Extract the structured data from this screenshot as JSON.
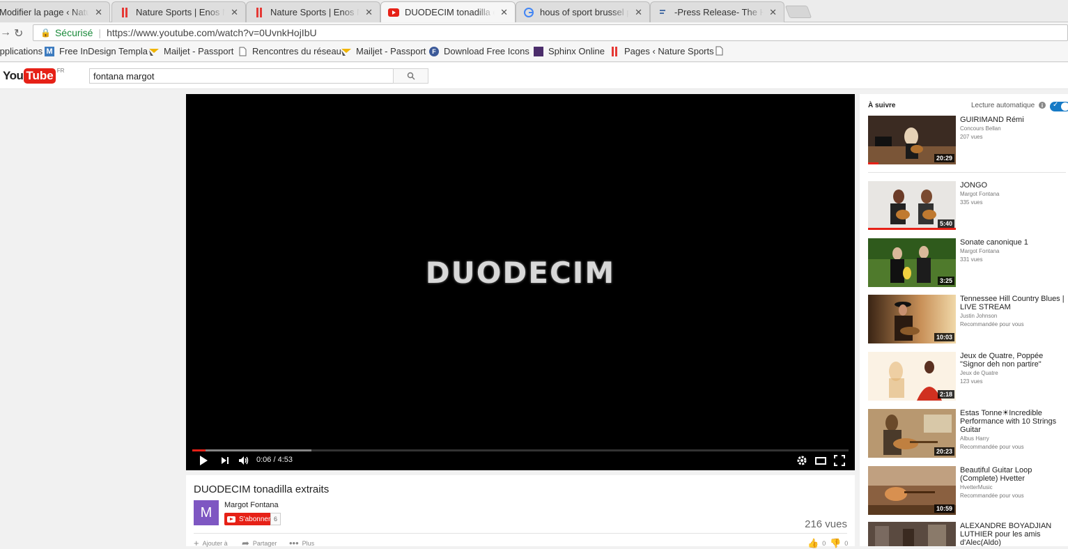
{
  "browser": {
    "tabs": [
      {
        "label": "Modifier la page ‹ Nature Sports",
        "favicon": "wordpress-icon"
      },
      {
        "label": "Nature Sports | Enos Net",
        "favicon": "nature-sports-icon"
      },
      {
        "label": "Nature Sports | Enos Net",
        "favicon": "nature-sports-icon"
      },
      {
        "label": "DUODECIM tonadilla extraits",
        "favicon": "youtube-icon",
        "active": true
      },
      {
        "label": "hous of sport brussel png",
        "favicon": "google-icon"
      },
      {
        "label": "-Press Release- The House",
        "favicon": "docs-icon"
      }
    ],
    "close_glyph": "✕",
    "secure_label": "Sécurisé",
    "url": "https://www.youtube.com/watch?v=0UvnkHojIbU",
    "bookmarks": [
      {
        "label": "Applications",
        "icon": "apps-icon"
      },
      {
        "label": "Free InDesign Templa",
        "icon": "m-icon"
      },
      {
        "label": "Mailjet - Passport",
        "icon": "mailjet-icon"
      },
      {
        "label": "Rencontres du réseau",
        "icon": "page-icon"
      },
      {
        "label": "Mailjet - Passport",
        "icon": "mailjet-icon"
      },
      {
        "label": "Download Free Icons",
        "icon": "f-icon"
      },
      {
        "label": "Sphinx Online",
        "icon": "sphinx-icon"
      },
      {
        "label": "Pages ‹ Nature Sports",
        "icon": "nature-sports-icon"
      }
    ]
  },
  "youtube": {
    "logo_you": "You",
    "logo_tube": "Tube",
    "logo_region": "FR",
    "search_value": "fontana margot"
  },
  "player": {
    "brand_text": "DUODECIM",
    "time": "0:06 / 4:53",
    "played_fraction": 0.02,
    "buffered_fraction": 0.182
  },
  "video": {
    "title": "DUODECIM tonadilla extraits",
    "avatar_letter": "M",
    "channel": "Margot Fontana",
    "subscribe_label": "S'abonner",
    "subscriber_count": "6",
    "views": "216 vues",
    "actions": {
      "add_label": "Ajouter à",
      "share_label": "Partager",
      "more_label": "Plus",
      "likes": "0",
      "dislikes": "0"
    }
  },
  "sidebar": {
    "up_next": "À suivre",
    "autoplay": "Lecture automatique",
    "items": [
      {
        "title": "GUIRIMAND Rémi",
        "channel": "Concours Bellan",
        "meta": "207 vues",
        "duration": "20:29",
        "watched": 0.12
      },
      {
        "title": "JONGO",
        "channel": "Margot Fontana",
        "meta": "335 vues",
        "duration": "5:40",
        "watched": 1.0
      },
      {
        "title": "Sonate canonique 1",
        "channel": "Margot Fontana",
        "meta": "331 vues",
        "duration": "3:25",
        "watched": 0
      },
      {
        "title": "Tennessee Hill Country Blues | LIVE STREAM",
        "channel": "Justin Johnson",
        "meta": "Recommandée pour vous",
        "duration": "10:03",
        "watched": 0
      },
      {
        "title": "Jeux de Quatre, Poppée \"Signor deh non partire\"",
        "channel": "Jeux de Quatre",
        "meta": "123 vues",
        "duration": "2:18",
        "watched": 0
      },
      {
        "title": "Estas Tonne☀Incredible Performance with 10 Strings Guitar",
        "channel": "Albus Harry",
        "meta": "Recommandée pour vous",
        "duration": "20:23",
        "watched": 0
      },
      {
        "title": "Beautiful Guitar Loop (Complete) Hvetter",
        "channel": "HvetterMusic",
        "meta": "Recommandée pour vous",
        "duration": "10:59",
        "watched": 0
      },
      {
        "title": "ALEXANDRE BOYADJIAN LUTHIER pour les amis d'Alec(Aldo)",
        "channel": "",
        "meta": "",
        "duration": "",
        "watched": 0
      }
    ]
  },
  "colors": {
    "youtube_red": "#e62117",
    "autoplay_blue": "#167ac6",
    "secure_green": "#1a8a3a"
  }
}
